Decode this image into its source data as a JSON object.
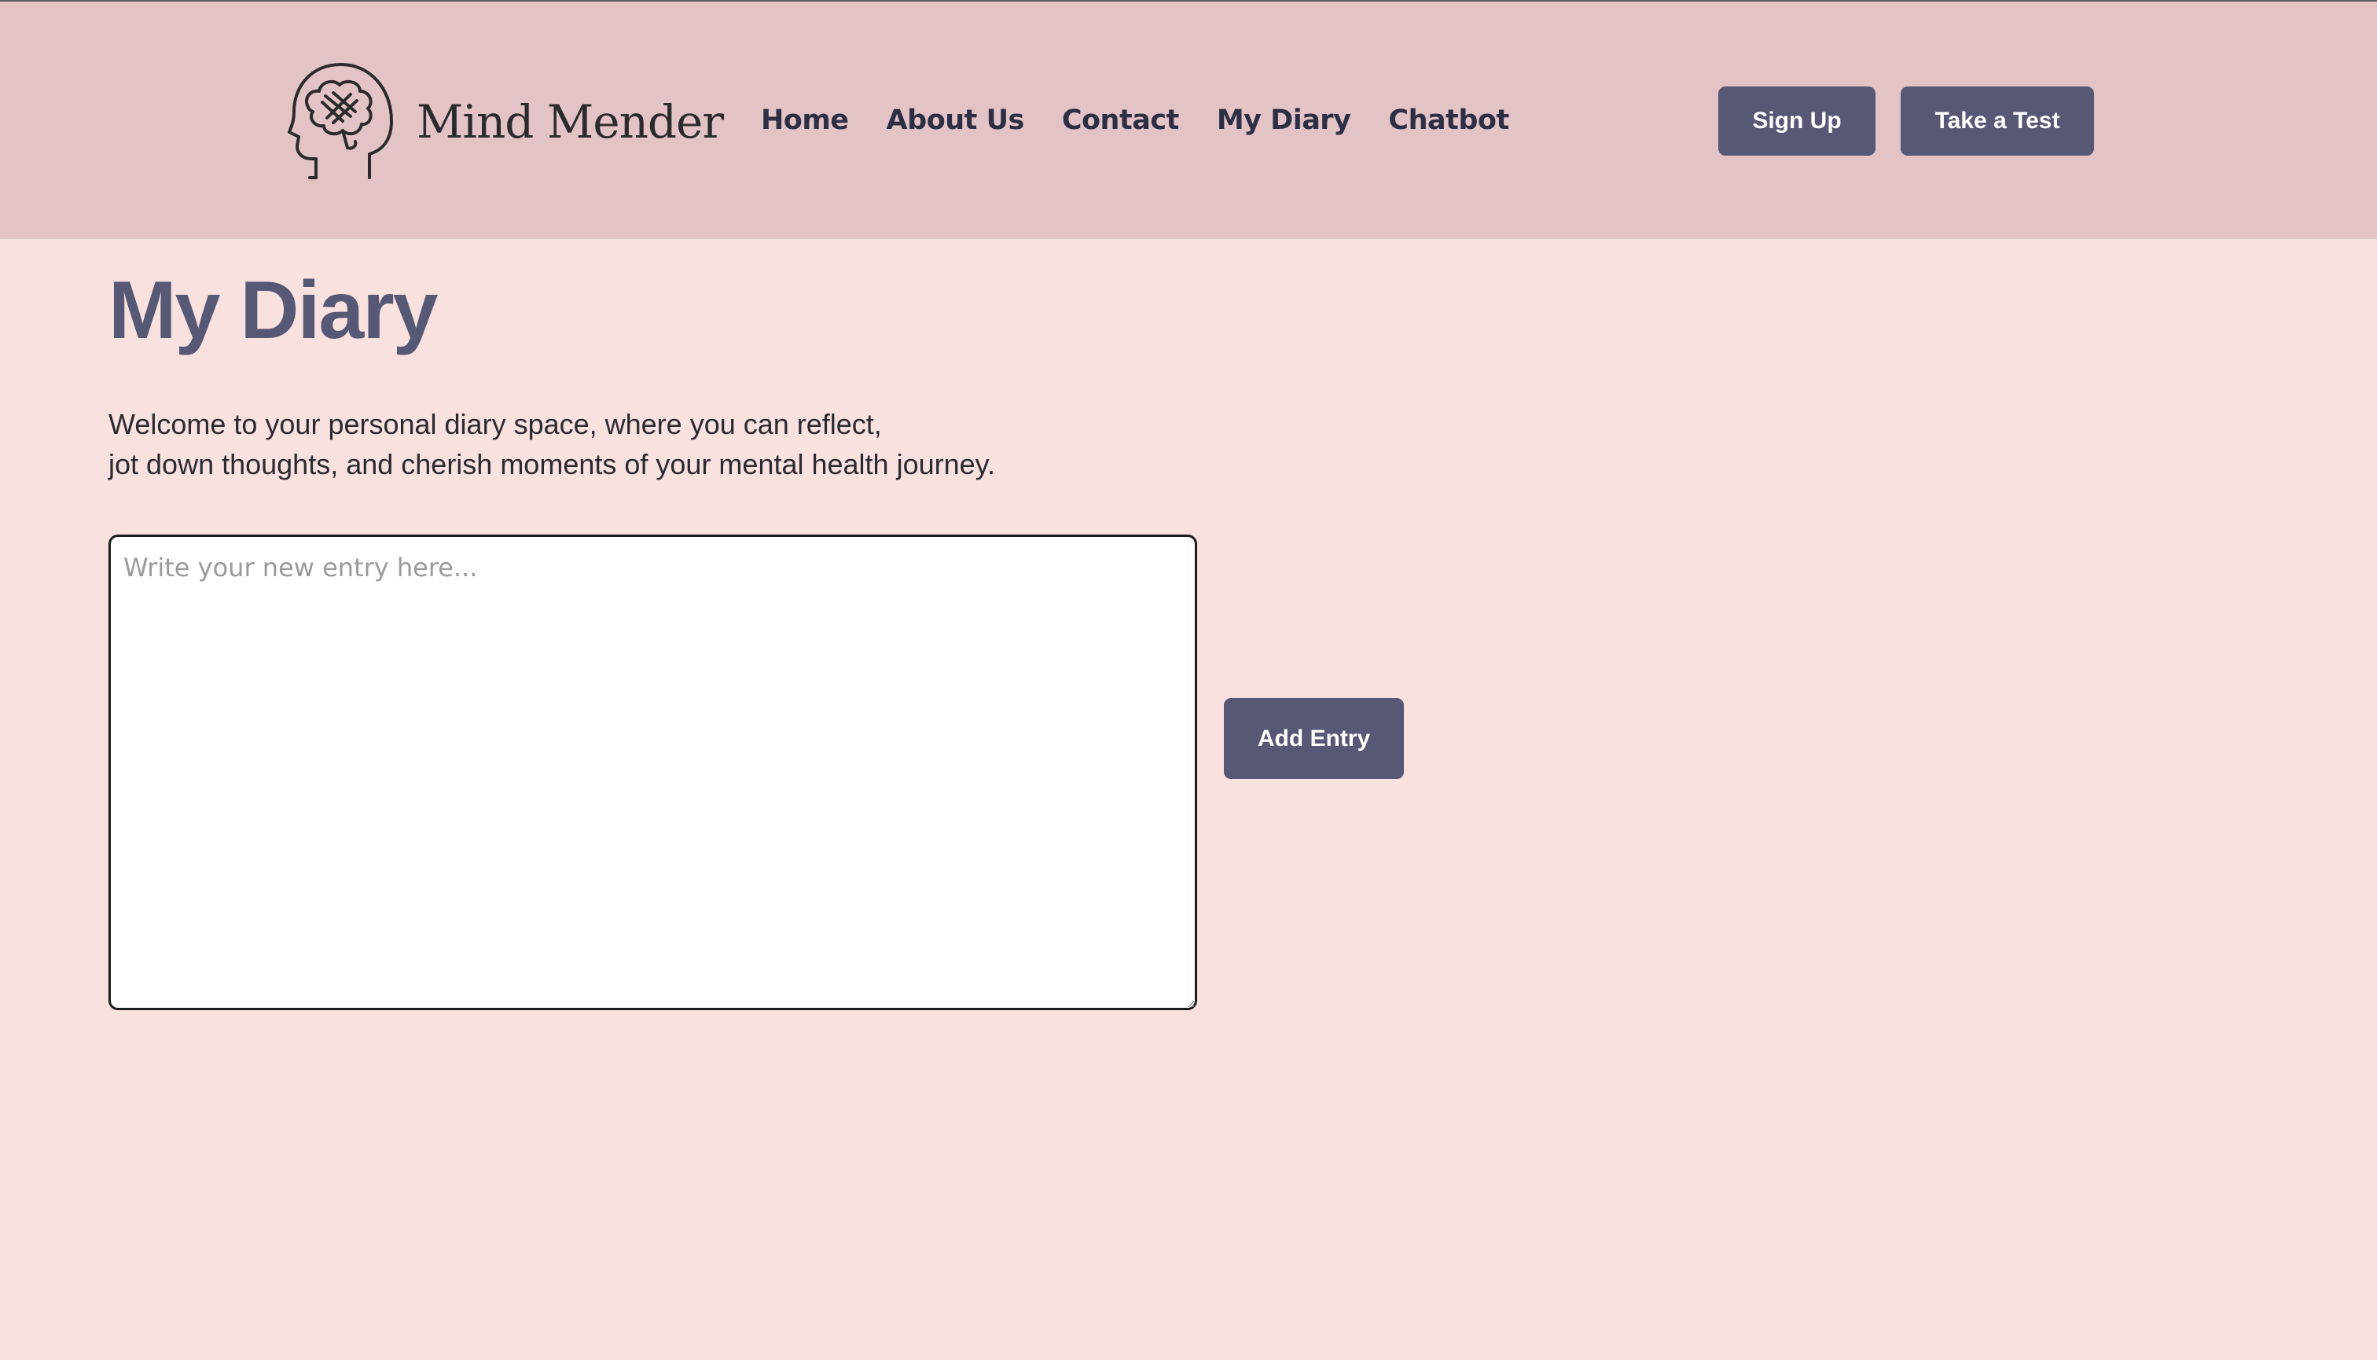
{
  "header": {
    "logo_text": "Mind Mender",
    "nav": [
      {
        "label": "Home"
      },
      {
        "label": "About Us"
      },
      {
        "label": "Contact"
      },
      {
        "label": "My Diary"
      },
      {
        "label": "Chatbot"
      }
    ],
    "signup_label": "Sign Up",
    "test_label": "Take a Test"
  },
  "main": {
    "title": "My Diary",
    "intro_line1": "Welcome to your personal diary space, where you can reflect,",
    "intro_line2": "jot down thoughts, and cherish moments of your mental health journey.",
    "entry_placeholder": "Write your new entry here...",
    "entry_value": "",
    "add_label": "Add Entry"
  },
  "colors": {
    "header_bg": "#e4c3c6",
    "page_bg": "#f8e1de",
    "accent": "#565876",
    "nav_text": "#2d2f45"
  },
  "icons": {
    "logo": "brain-head-bandage-icon"
  }
}
